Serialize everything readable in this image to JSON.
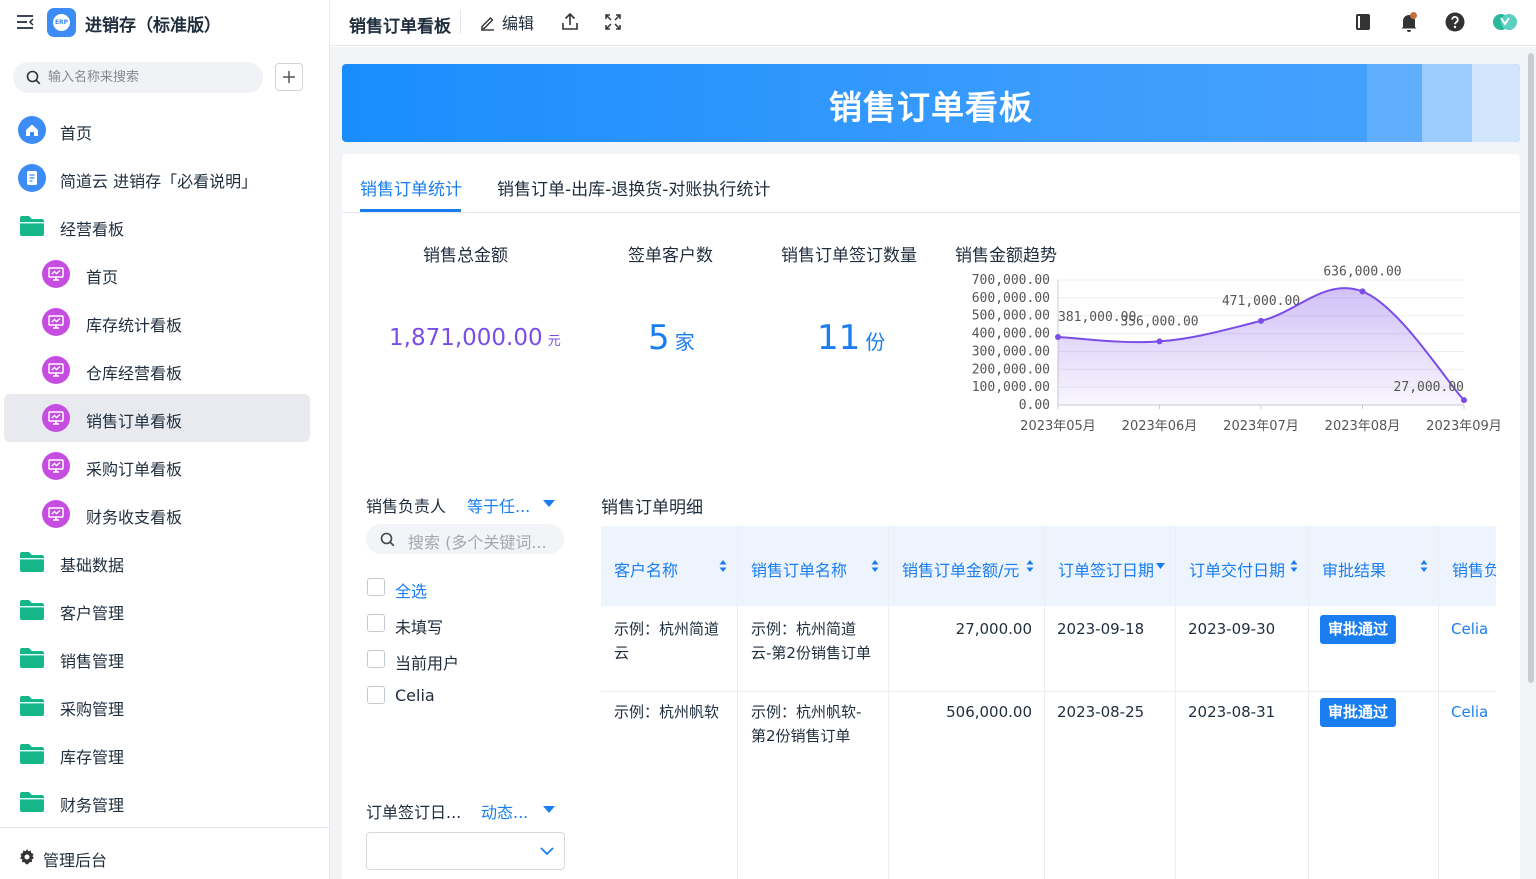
{
  "app": {
    "title": "进销存（标准版）",
    "logo_text": "ERP"
  },
  "search": {
    "placeholder": "输入名称来搜索"
  },
  "nav": [
    {
      "label": "首页",
      "icon": "home-icon"
    },
    {
      "label": "简道云 进销存「必看说明」",
      "icon": "document-icon"
    },
    {
      "label": "经营看板",
      "icon": "folder-icon"
    },
    {
      "label": "首页",
      "icon": "dashboard-icon"
    },
    {
      "label": "库存统计看板",
      "icon": "dashboard-icon"
    },
    {
      "label": "仓库经营看板",
      "icon": "dashboard-icon"
    },
    {
      "label": "销售订单看板",
      "icon": "dashboard-icon",
      "active": true
    },
    {
      "label": "采购订单看板",
      "icon": "dashboard-icon"
    },
    {
      "label": "财务收支看板",
      "icon": "dashboard-icon"
    },
    {
      "label": "基础数据",
      "icon": "folder-icon"
    },
    {
      "label": "客户管理",
      "icon": "folder-icon"
    },
    {
      "label": "销售管理",
      "icon": "folder-icon"
    },
    {
      "label": "采购管理",
      "icon": "folder-icon"
    },
    {
      "label": "库存管理",
      "icon": "folder-icon"
    },
    {
      "label": "财务管理",
      "icon": "folder-icon"
    }
  ],
  "footer": {
    "admin_label": "管理后台"
  },
  "topbar": {
    "title": "销售订单看板",
    "edit_label": "编辑"
  },
  "banner": {
    "title": "销售订单看板"
  },
  "tabs": [
    "销售订单统计",
    "销售订单-出库-退换货-对账执行统计"
  ],
  "stats": {
    "total_amount": {
      "label": "销售总金额",
      "value": "1,871,000.00",
      "unit": "元"
    },
    "customers": {
      "label": "签单客户数",
      "value": "5",
      "unit": "家"
    },
    "orders": {
      "label": "销售订单签订数量",
      "value": "11",
      "unit": "份"
    }
  },
  "chart_data": {
    "type": "area",
    "title": "销售金额趋势",
    "categories": [
      "2023年05月",
      "2023年06月",
      "2023年07月",
      "2023年08月",
      "2023年09月"
    ],
    "values": [
      381000,
      356000,
      471000,
      636000,
      27000
    ],
    "data_labels": [
      "381,000.00",
      "356,000.00",
      "471,000.00",
      "636,000.00",
      "27,000.00"
    ],
    "yticks": [
      "0.00",
      "100,000.00",
      "200,000.00",
      "300,000.00",
      "400,000.00",
      "500,000.00",
      "600,000.00",
      "700,000.00"
    ],
    "ylim": [
      0,
      700000
    ],
    "color": "#7b4de8",
    "grid": true
  },
  "filters": {
    "owner": {
      "label": "销售负责人",
      "operator": "等于任...",
      "search_placeholder": "搜索 (多个关键词...",
      "options": [
        "全选",
        "未填写",
        "当前用户",
        "Celia"
      ]
    },
    "date": {
      "label": "订单签订日...",
      "operator": "动态..."
    }
  },
  "table": {
    "title": "销售订单明细",
    "columns": [
      "客户名称",
      "销售订单名称",
      "销售订单金额/元",
      "订单签订日期",
      "订单交付日期",
      "审批结果",
      "销售负"
    ],
    "rows": [
      {
        "customer_l1": "示例：杭州简道",
        "customer_l2": "云",
        "order_l1": "示例：杭州简道",
        "order_l2": "云-第2份销售订单",
        "amount": "27,000.00",
        "sign_date": "2023-09-18",
        "deliver_date": "2023-09-30",
        "approval": "审批通过",
        "owner": "Celia"
      },
      {
        "customer_l1": "示例：杭州帆软",
        "customer_l2": "",
        "order_l1": "示例：杭州帆软-",
        "order_l2": "第2份销售订单",
        "amount": "506,000.00",
        "sign_date": "2023-08-25",
        "deliver_date": "2023-08-31",
        "approval": "审批通过",
        "owner": "Celia"
      }
    ]
  }
}
